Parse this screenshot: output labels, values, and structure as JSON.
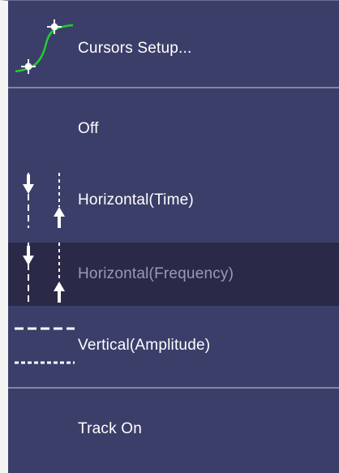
{
  "menu": {
    "items": [
      {
        "label": "Cursors Setup...",
        "icon": "cursor-curve-icon"
      },
      {
        "label": "Off",
        "icon": ""
      },
      {
        "label": "Horizontal(Time)",
        "icon": "horizontal-cursor-arrows-icon"
      },
      {
        "label": "Horizontal(Frequency)",
        "icon": "horizontal-cursor-arrows-icon",
        "selected": true
      },
      {
        "label": "Vertical(Amplitude)",
        "icon": "vertical-cursor-dashed-lines-icon"
      },
      {
        "label": "Track On",
        "icon": ""
      }
    ]
  },
  "colors": {
    "menu_background": "#3c3e6a",
    "selected_background": "#2a2947",
    "separator": "#8384a6",
    "text": "#ffffff",
    "selected_text": "#9a9ab4",
    "curve": "#22cc33"
  }
}
